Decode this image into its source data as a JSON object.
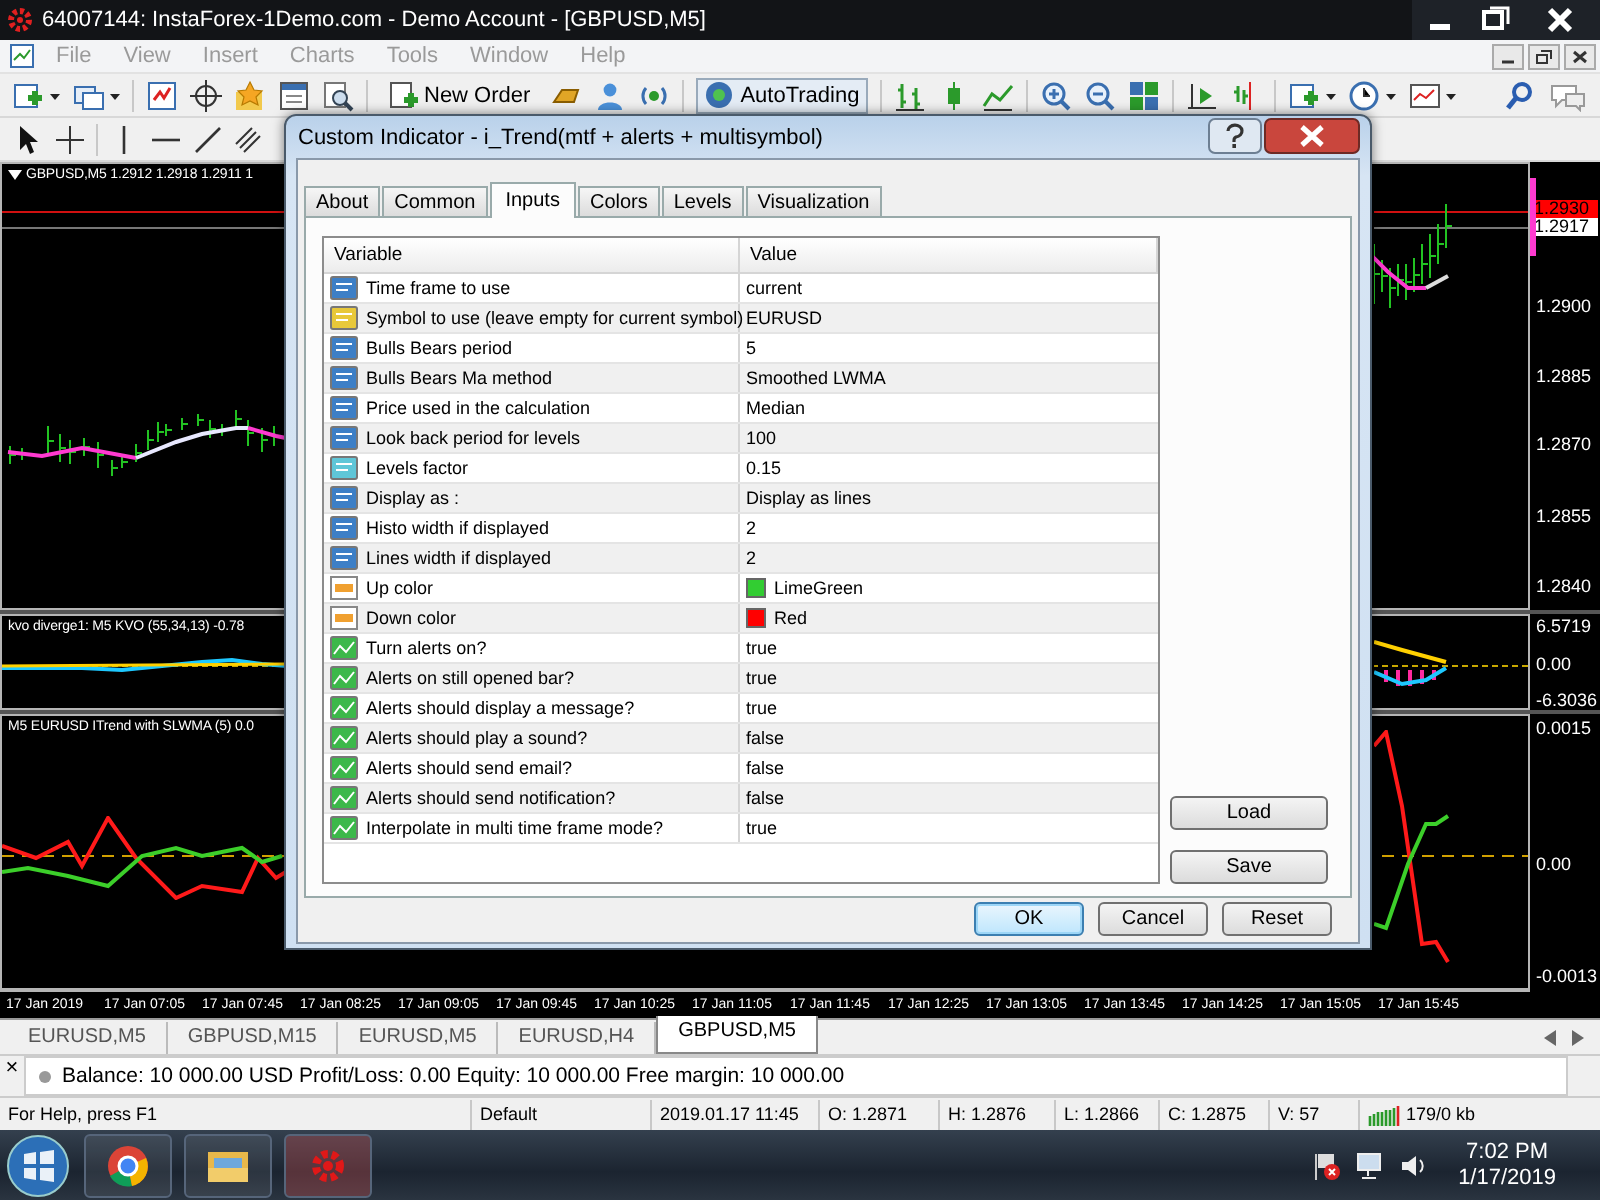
{
  "window": {
    "title": "64007144: InstaForex-1Demo.com - Demo Account - [GBPUSD,M5]"
  },
  "menu": [
    {
      "label": "File",
      "disabled": true
    },
    {
      "label": "View",
      "disabled": true
    },
    {
      "label": "Insert",
      "disabled": true
    },
    {
      "label": "Charts",
      "disabled": true
    },
    {
      "label": "Tools",
      "disabled": true
    },
    {
      "label": "Window",
      "disabled": true
    },
    {
      "label": "Help",
      "disabled": true
    }
  ],
  "toolbar": {
    "buttons": [
      {
        "label": "New Order",
        "pressed": false
      },
      {
        "label": "AutoTrading",
        "pressed": true
      }
    ]
  },
  "chart": {
    "label": "GBPUSD,M5  1.2912 1.2918 1.2911 1",
    "price_tags": [
      {
        "text": "1.2930",
        "color": "#ff0000"
      },
      {
        "text": "1.2917",
        "color": "#ffffff"
      }
    ],
    "price_scale": [
      "1.2900",
      "1.2885",
      "1.2870",
      "1.2855",
      "1.2840"
    ],
    "indicators": [
      {
        "label": "kvo diverge1: M5  KVO (55,34,13) -0.78",
        "scale": [
          "6.5719",
          "0.00",
          "-6.3036"
        ]
      },
      {
        "label": "M5 EURUSD ITrend with SLWMA (5) 0.0",
        "scale": [
          "0.0015",
          "0.00",
          "-0.0013"
        ]
      }
    ],
    "time_axis": [
      "17 Jan 2019",
      "17 Jan 07:05",
      "17 Jan 07:45",
      "17 Jan 08:25",
      "17 Jan 09:05",
      "17 Jan 09:45",
      "17 Jan 10:25",
      "17 Jan 11:05",
      "17 Jan 11:45",
      "17 Jan 12:25",
      "17 Jan 13:05",
      "17 Jan 13:45",
      "17 Jan 14:25",
      "17 Jan 15:05",
      "17 Jan 15:45"
    ]
  },
  "chart_tabs": [
    {
      "label": "EURUSD,M5",
      "selected": false
    },
    {
      "label": "GBPUSD,M15",
      "selected": false
    },
    {
      "label": "EURUSD,M5",
      "selected": false
    },
    {
      "label": "EURUSD,H4",
      "selected": false
    },
    {
      "label": "GBPUSD,M5",
      "selected": true
    }
  ],
  "terminal": {
    "close": "×",
    "text": "Balance: 10 000.00 USD  Profit/Loss: 0.00  Equity: 10 000.00  Free margin: 10 000.00"
  },
  "status_bar": [
    "For Help, press F1",
    "Default",
    "2019.01.17 11:45",
    "O: 1.2871",
    "H: 1.2876",
    "L: 1.2866",
    "C: 1.2875",
    "V: 57",
    "179/0 kb"
  ],
  "taskbar": {
    "time": "7:02 PM",
    "date": "1/17/2019"
  },
  "dialog": {
    "title": "Custom Indicator - i_Trend(mtf + alerts + multisymbol)",
    "tabs": [
      {
        "label": "About",
        "selected": false
      },
      {
        "label": "Common",
        "selected": false
      },
      {
        "label": "Inputs",
        "selected": true
      },
      {
        "label": "Colors",
        "selected": false
      },
      {
        "label": "Levels",
        "selected": false
      },
      {
        "label": "Visualization",
        "selected": false
      }
    ],
    "columns": [
      "Variable",
      "Value"
    ],
    "rows": [
      {
        "kind": "int",
        "variable": "Time frame to use",
        "value": "current"
      },
      {
        "kind": "string",
        "variable": "Symbol to use (leave empty for current symbol)",
        "value": "EURUSD"
      },
      {
        "kind": "int",
        "variable": "Bulls Bears period",
        "value": "5"
      },
      {
        "kind": "int",
        "variable": "Bulls Bears Ma method",
        "value": "Smoothed LWMA"
      },
      {
        "kind": "int",
        "variable": "Price used in the calculation",
        "value": "Median"
      },
      {
        "kind": "int",
        "variable": "Look back period for levels",
        "value": "100"
      },
      {
        "kind": "double",
        "variable": "Levels factor",
        "value": "0.15"
      },
      {
        "kind": "int",
        "variable": "Display as :",
        "value": "Display as lines"
      },
      {
        "kind": "int",
        "variable": "Histo width if displayed",
        "value": "2"
      },
      {
        "kind": "int",
        "variable": "Lines width if displayed",
        "value": "2"
      },
      {
        "kind": "color",
        "variable": "Up color",
        "value": "LimeGreen",
        "color": "#32cd32"
      },
      {
        "kind": "color",
        "variable": "Down color",
        "value": "Red",
        "color": "#ff0000"
      },
      {
        "kind": "bool",
        "variable": "Turn alerts on?",
        "value": "true"
      },
      {
        "kind": "bool",
        "variable": "Alerts on still opened bar?",
        "value": "true"
      },
      {
        "kind": "bool",
        "variable": "Alerts should display a message?",
        "value": "true"
      },
      {
        "kind": "bool",
        "variable": "Alerts should play a sound?",
        "value": "false"
      },
      {
        "kind": "bool",
        "variable": "Alerts should send email?",
        "value": "false"
      },
      {
        "kind": "bool",
        "variable": "Alerts should send notification?",
        "value": "false"
      },
      {
        "kind": "bool",
        "variable": "Interpolate in multi time frame mode?",
        "value": "true"
      }
    ],
    "side_buttons": [
      "Load",
      "Save"
    ],
    "buttons": [
      {
        "label": "OK",
        "default": true
      },
      {
        "label": "Cancel",
        "default": false
      },
      {
        "label": "Reset",
        "default": false
      }
    ]
  }
}
